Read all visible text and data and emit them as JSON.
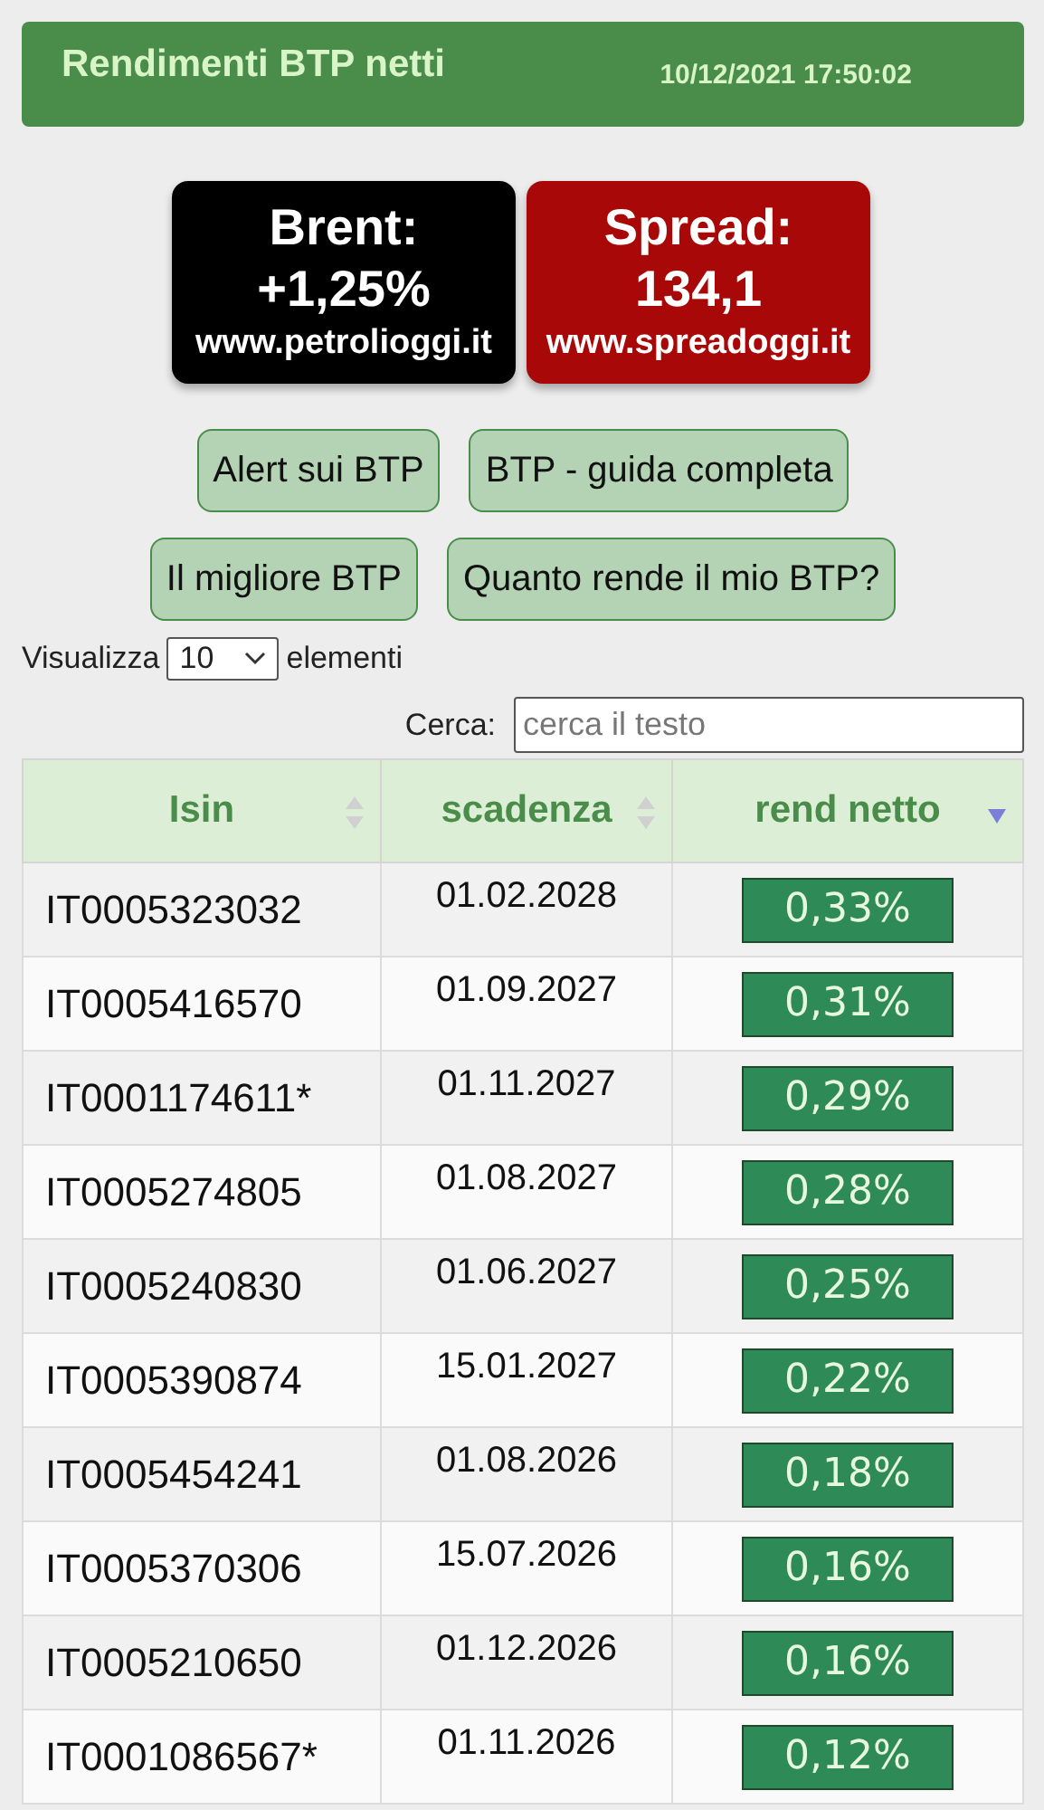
{
  "header": {
    "title": "Rendimenti BTP netti",
    "datetime": "10/12/2021 17:50:02"
  },
  "tickers": [
    {
      "kind": "brent",
      "label": "Brent:",
      "value": "+1,25%",
      "site": "www.petrolioggi.it"
    },
    {
      "kind": "spread",
      "label": "Spread:",
      "value": "134,1",
      "site": "www.spreadoggi.it"
    }
  ],
  "link_buttons": [
    [
      "Alert sui BTP",
      "BTP - guida completa"
    ],
    [
      "Il migliore BTP",
      "Quanto rende il mio BTP?"
    ]
  ],
  "length_control": {
    "before": "Visualizza",
    "value": "10",
    "after": "elementi"
  },
  "search": {
    "label": "Cerca:",
    "placeholder": "cerca il testo"
  },
  "table": {
    "columns": [
      {
        "label": "Isin",
        "sorted": false
      },
      {
        "label": "scadenza",
        "sorted": false
      },
      {
        "label": "rend netto",
        "sorted": true
      }
    ],
    "rows": [
      [
        "IT0005323032",
        "01.02.2028",
        "0,33%"
      ],
      [
        "IT0005416570",
        "01.09.2027",
        "0,31%"
      ],
      [
        "IT0001174611*",
        "01.11.2027",
        "0,29%"
      ],
      [
        "IT0005274805",
        "01.08.2027",
        "0,28%"
      ],
      [
        "IT0005240830",
        "01.06.2027",
        "0,25%"
      ],
      [
        "IT0005390874",
        "15.01.2027",
        "0,22%"
      ],
      [
        "IT0005454241",
        "01.08.2026",
        "0,18%"
      ],
      [
        "IT0005370306",
        "15.07.2026",
        "0,16%"
      ],
      [
        "IT0005210650",
        "01.12.2026",
        "0,16%"
      ],
      [
        "IT0001086567*",
        "01.11.2026",
        "0,12%"
      ]
    ]
  }
}
